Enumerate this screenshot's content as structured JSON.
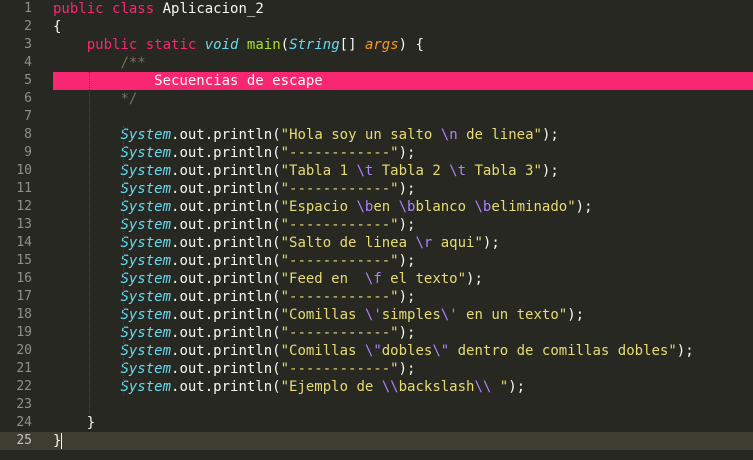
{
  "editor": {
    "lines": [
      {
        "n": "1",
        "tokens": [
          [
            "kw",
            "public"
          ],
          [
            "txt",
            " "
          ],
          [
            "kw",
            "class"
          ],
          [
            "txt",
            " Aplicacion_2"
          ]
        ]
      },
      {
        "n": "2",
        "tokens": [
          [
            "txt",
            "{"
          ]
        ]
      },
      {
        "n": "3",
        "tokens": [
          [
            "txt",
            "    "
          ],
          [
            "kw",
            "public"
          ],
          [
            "txt",
            " "
          ],
          [
            "kw",
            "static"
          ],
          [
            "txt",
            " "
          ],
          [
            "typ",
            "void"
          ],
          [
            "txt",
            " "
          ],
          [
            "fn",
            "main"
          ],
          [
            "txt",
            "("
          ],
          [
            "typ",
            "String"
          ],
          [
            "txt",
            "[] "
          ],
          [
            "prm",
            "args"
          ],
          [
            "txt",
            ") {"
          ]
        ]
      },
      {
        "n": "4",
        "tokens": [
          [
            "txt",
            "        "
          ],
          [
            "cmt",
            "/**"
          ]
        ]
      },
      {
        "n": "5",
        "tokens": [
          [
            "txt",
            "            Secuencias de escape"
          ]
        ]
      },
      {
        "n": "6",
        "tokens": [
          [
            "txt",
            "        "
          ],
          [
            "cmt",
            "*/"
          ]
        ]
      },
      {
        "n": "7",
        "tokens": []
      },
      {
        "n": "8",
        "tokens": [
          [
            "txt",
            "        "
          ],
          [
            "typ",
            "System"
          ],
          [
            "txt",
            "."
          ],
          [
            "txt",
            "out"
          ],
          [
            "txt",
            "."
          ],
          [
            "txt",
            "println"
          ],
          [
            "txt",
            "("
          ],
          [
            "str",
            "\"Hola soy un salto "
          ],
          [
            "esc",
            "\\n"
          ],
          [
            "str",
            " de linea\""
          ],
          [
            "txt",
            ");"
          ]
        ]
      },
      {
        "n": "9",
        "tokens": [
          [
            "txt",
            "        "
          ],
          [
            "typ",
            "System"
          ],
          [
            "txt",
            ".out.println("
          ],
          [
            "str",
            "\"------------\""
          ],
          [
            "txt",
            ");"
          ]
        ]
      },
      {
        "n": "10",
        "tokens": [
          [
            "txt",
            "        "
          ],
          [
            "typ",
            "System"
          ],
          [
            "txt",
            ".out.println("
          ],
          [
            "str",
            "\"Tabla 1 "
          ],
          [
            "esc",
            "\\t"
          ],
          [
            "str",
            " Tabla 2 "
          ],
          [
            "esc",
            "\\t"
          ],
          [
            "str",
            " Tabla 3\""
          ],
          [
            "txt",
            ");"
          ]
        ]
      },
      {
        "n": "11",
        "tokens": [
          [
            "txt",
            "        "
          ],
          [
            "typ",
            "System"
          ],
          [
            "txt",
            ".out.println("
          ],
          [
            "str",
            "\"------------\""
          ],
          [
            "txt",
            ");"
          ]
        ]
      },
      {
        "n": "12",
        "tokens": [
          [
            "txt",
            "        "
          ],
          [
            "typ",
            "System"
          ],
          [
            "txt",
            ".out.println("
          ],
          [
            "str",
            "\"Espacio "
          ],
          [
            "esc",
            "\\b"
          ],
          [
            "str",
            "en "
          ],
          [
            "esc",
            "\\b"
          ],
          [
            "str",
            "blanco "
          ],
          [
            "esc",
            "\\b"
          ],
          [
            "str",
            "eliminado\""
          ],
          [
            "txt",
            ");"
          ]
        ]
      },
      {
        "n": "13",
        "tokens": [
          [
            "txt",
            "        "
          ],
          [
            "typ",
            "System"
          ],
          [
            "txt",
            ".out.println("
          ],
          [
            "str",
            "\"------------\""
          ],
          [
            "txt",
            ");"
          ]
        ]
      },
      {
        "n": "14",
        "tokens": [
          [
            "txt",
            "        "
          ],
          [
            "typ",
            "System"
          ],
          [
            "txt",
            ".out.println("
          ],
          [
            "str",
            "\"Salto de linea "
          ],
          [
            "esc",
            "\\r"
          ],
          [
            "str",
            " aqui\""
          ],
          [
            "txt",
            ");"
          ]
        ]
      },
      {
        "n": "15",
        "tokens": [
          [
            "txt",
            "        "
          ],
          [
            "typ",
            "System"
          ],
          [
            "txt",
            ".out.println("
          ],
          [
            "str",
            "\"------------\""
          ],
          [
            "txt",
            ");"
          ]
        ]
      },
      {
        "n": "16",
        "tokens": [
          [
            "txt",
            "        "
          ],
          [
            "typ",
            "System"
          ],
          [
            "txt",
            ".out.println("
          ],
          [
            "str",
            "\"Feed en  "
          ],
          [
            "esc",
            "\\f"
          ],
          [
            "str",
            " el texto\""
          ],
          [
            "txt",
            ");"
          ]
        ]
      },
      {
        "n": "17",
        "tokens": [
          [
            "txt",
            "        "
          ],
          [
            "typ",
            "System"
          ],
          [
            "txt",
            ".out.println("
          ],
          [
            "str",
            "\"------------\""
          ],
          [
            "txt",
            ");"
          ]
        ]
      },
      {
        "n": "18",
        "tokens": [
          [
            "txt",
            "        "
          ],
          [
            "typ",
            "System"
          ],
          [
            "txt",
            ".out.println("
          ],
          [
            "str",
            "\"Comillas "
          ],
          [
            "esc",
            "\\'"
          ],
          [
            "str",
            "simples"
          ],
          [
            "esc",
            "\\'"
          ],
          [
            "str",
            " en un texto\""
          ],
          [
            "txt",
            ");"
          ]
        ]
      },
      {
        "n": "19",
        "tokens": [
          [
            "txt",
            "        "
          ],
          [
            "typ",
            "System"
          ],
          [
            "txt",
            ".out.println("
          ],
          [
            "str",
            "\"------------\""
          ],
          [
            "txt",
            ");"
          ]
        ]
      },
      {
        "n": "20",
        "tokens": [
          [
            "txt",
            "        "
          ],
          [
            "typ",
            "System"
          ],
          [
            "txt",
            ".out.println("
          ],
          [
            "str",
            "\"Comillas "
          ],
          [
            "esc",
            "\\\""
          ],
          [
            "str",
            "dobles"
          ],
          [
            "esc",
            "\\\""
          ],
          [
            "str",
            " dentro de comillas dobles\""
          ],
          [
            "txt",
            ");"
          ]
        ]
      },
      {
        "n": "21",
        "tokens": [
          [
            "txt",
            "        "
          ],
          [
            "typ",
            "System"
          ],
          [
            "txt",
            ".out.println("
          ],
          [
            "str",
            "\"------------\""
          ],
          [
            "txt",
            ");"
          ]
        ]
      },
      {
        "n": "22",
        "tokens": [
          [
            "txt",
            "        "
          ],
          [
            "typ",
            "System"
          ],
          [
            "txt",
            ".out.println("
          ],
          [
            "str",
            "\"Ejemplo de "
          ],
          [
            "esc",
            "\\\\"
          ],
          [
            "str",
            "backslash"
          ],
          [
            "esc",
            "\\\\"
          ],
          [
            "str",
            " \""
          ],
          [
            "txt",
            ");"
          ]
        ]
      },
      {
        "n": "23",
        "tokens": []
      },
      {
        "n": "24",
        "tokens": [
          [
            "txt",
            "    }"
          ]
        ]
      },
      {
        "n": "25",
        "tokens": [
          [
            "txt",
            "}"
          ]
        ]
      }
    ],
    "highlighted_line": 5,
    "active_line": 25,
    "colors": {
      "background": "#272822",
      "highlight": "#f92672",
      "keyword": "#f92672",
      "type": "#66d9ef",
      "function": "#a6e22e",
      "string": "#e6db74",
      "escape": "#ae81ff",
      "comment": "#75715e",
      "parameter": "#fd971f"
    }
  }
}
